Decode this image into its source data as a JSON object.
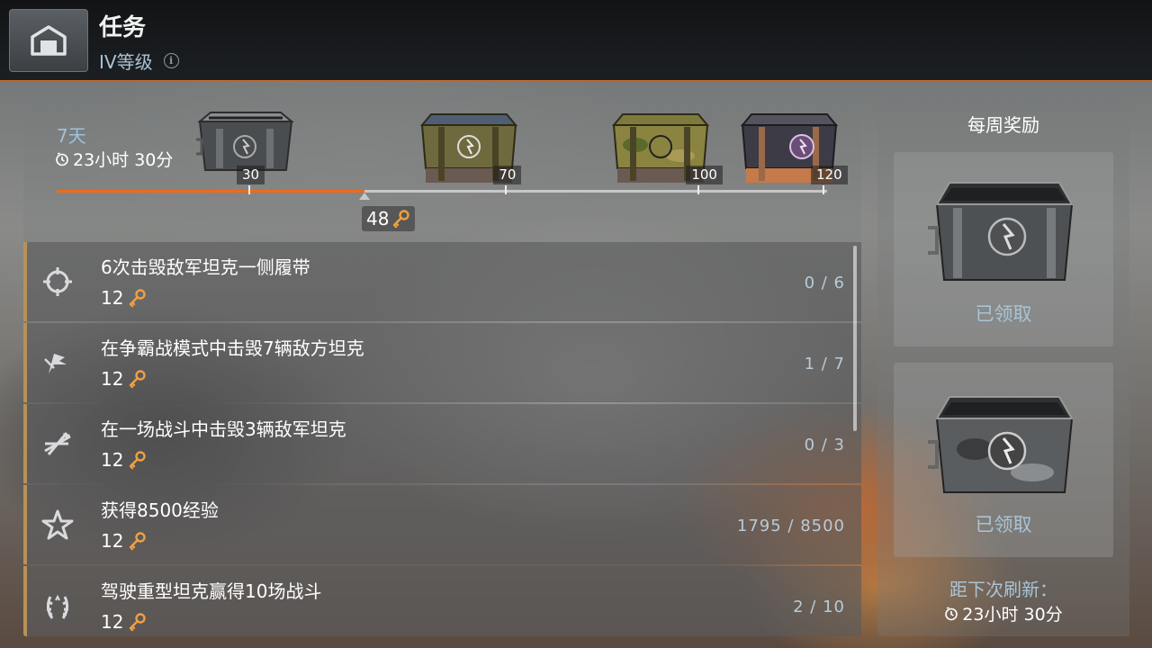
{
  "header": {
    "title": "任务",
    "tier": "IV等级",
    "info_icon": "i"
  },
  "progress": {
    "timer_days": "7天",
    "timer_hours": "23小时 30分",
    "current_keys": "48",
    "max_keys": 120,
    "current_value": 48,
    "milestones": [
      {
        "label": "30",
        "value": 30,
        "crate": "steel-crate"
      },
      {
        "label": "70",
        "value": 70,
        "crate": "green-crate"
      },
      {
        "label": "100",
        "value": 100,
        "crate": "camo-crate"
      },
      {
        "label": "120",
        "value": 120,
        "crate": "premium-crate"
      }
    ],
    "colors": {
      "fill": "#f06a1c",
      "track": "#c8c8c8"
    }
  },
  "missions": [
    {
      "title": "6次击毁敌军坦克一侧履带",
      "reward": "12",
      "progress": "0 / 6",
      "icon": "crosshair-icon"
    },
    {
      "title": "在争霸战模式中击毁7辆敌方坦克",
      "reward": "12",
      "progress": "1 / 7",
      "icon": "flags-icon"
    },
    {
      "title": "在一场战斗中击毁3辆敌军坦克",
      "reward": "12",
      "progress": "0 / 3",
      "icon": "crossed-arrows-icon"
    },
    {
      "title": "获得8500经验",
      "reward": "12",
      "progress": "1795 / 8500",
      "icon": "star-icon"
    },
    {
      "title": "驾驶重型坦克赢得10场战斗",
      "reward": "12",
      "progress": "2 / 10",
      "icon": "laurel-icon"
    }
  ],
  "weekly": {
    "title": "每周奖励",
    "rewards": [
      {
        "status": "已领取",
        "crate": "steel-crate"
      },
      {
        "status": "已领取",
        "crate": "camo-steel-crate"
      }
    ],
    "refresh_label": "距下次刷新：",
    "refresh_time": "23小时 30分"
  },
  "colors": {
    "accent": "#f06a1c",
    "mission_border": "#b89158",
    "muted_blue": "#a9c4d6"
  }
}
